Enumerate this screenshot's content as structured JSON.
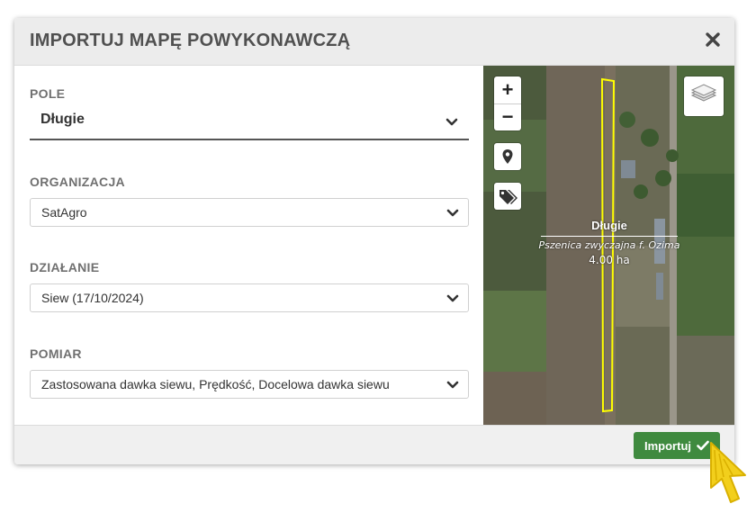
{
  "dialog": {
    "title": "IMPORTUJ MAPĘ POWYKONAWCZĄ",
    "close_icon": "close-icon"
  },
  "form": {
    "pole": {
      "label": "POLE",
      "value": "Długie"
    },
    "organizacja": {
      "label": "ORGANIZACJA",
      "value": "SatAgro"
    },
    "dzialanie": {
      "label": "DZIAŁANIE",
      "value": "Siew (17/10/2024)"
    },
    "pomiar": {
      "label": "POMIAR",
      "value": "Zastosowana dawka siewu, Prędkość, Docelowa dawka siewu"
    }
  },
  "map": {
    "zoom_in": "+",
    "zoom_out": "−",
    "field": {
      "name": "Długie",
      "crop": "Pszenica zwyczajna f. Ozima",
      "area": "4.00 ha"
    },
    "boundary_color": "#ffff00",
    "icons": [
      "zoom-in-icon",
      "zoom-out-icon",
      "location-pin-icon",
      "tags-icon",
      "layers-icon"
    ]
  },
  "footer": {
    "import_label": "Importuj",
    "import_color": "#3f8a3f"
  }
}
